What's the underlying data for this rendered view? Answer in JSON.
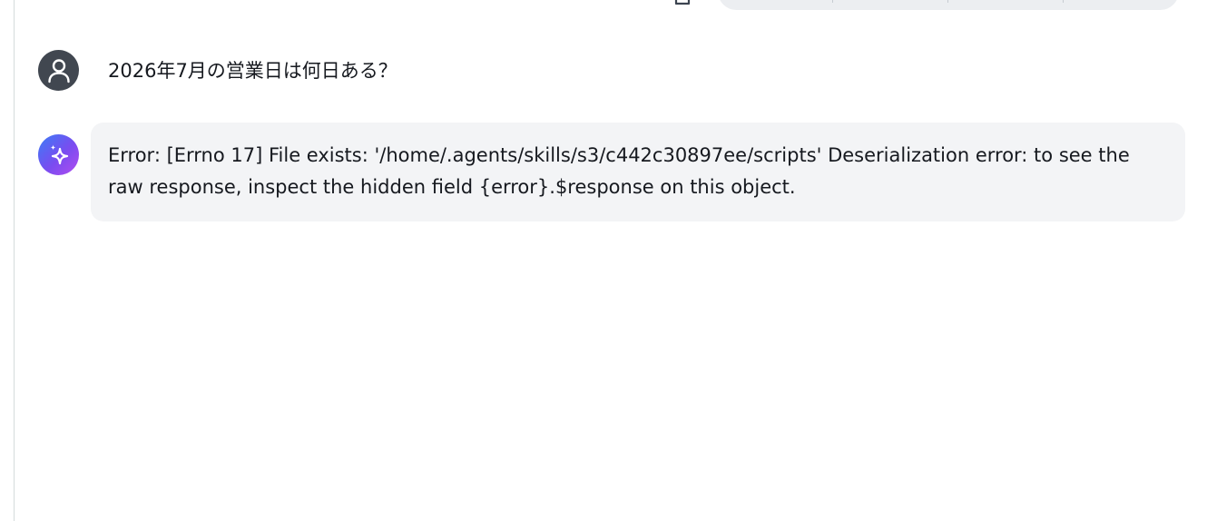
{
  "conversation": {
    "user_message": {
      "avatar_icon": "user-icon",
      "text": "2026年7月の営業日は何日ある？"
    },
    "assistant_message": {
      "avatar_icon": "sparkle-icon",
      "text": "Error: [Errno 17] File exists: '/home/.agents/skills/s3/c442c30897ee/scripts' Deserialization error: to see the raw response, inspect the hidden field {error}.$response on this object."
    }
  },
  "toolbar": {
    "copy_icon": "copy-icon"
  },
  "colors": {
    "user_avatar_bg": "#414750",
    "assistant_avatar_gradient": [
      "#3b7cf6",
      "#7a4cf0",
      "#b24df0"
    ],
    "assistant_bubble_bg": "#f3f4f6",
    "action_pill_bg": "#eceef1"
  }
}
